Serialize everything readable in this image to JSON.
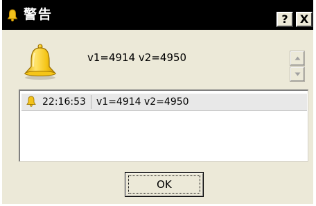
{
  "window": {
    "title": "警告",
    "help_label": "?",
    "close_label": "X"
  },
  "alert": {
    "message": "v1=4914 v2=4950"
  },
  "log": {
    "rows": [
      {
        "time": "22:16:53",
        "message": "v1=4914 v2=4950"
      }
    ]
  },
  "buttons": {
    "ok_label": "OK"
  },
  "icons": {
    "title": "bell-icon",
    "main": "bell-icon",
    "row": "bell-icon",
    "scroll_up": "arrow-up-icon",
    "scroll_down": "arrow-down-icon"
  },
  "colors": {
    "titlebar": "#000000",
    "dialog_bg": "#ece9d8",
    "bell_gold": "#f3c21b",
    "row_bg": "#e8e8e8"
  }
}
